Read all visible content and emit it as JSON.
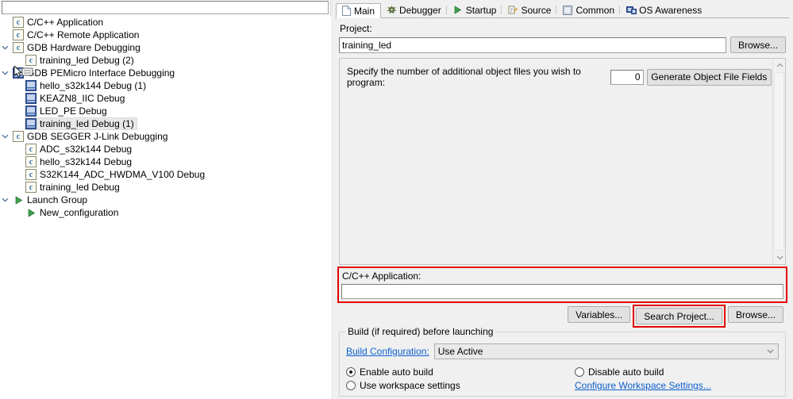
{
  "filter": {
    "value": "",
    "placeholder": ""
  },
  "tree": {
    "items": [
      {
        "label": "C/C++ Application",
        "icon": "c-launch-icon",
        "indent": 0,
        "twisty": "none",
        "selected": false
      },
      {
        "label": "C/C++ Remote Application",
        "icon": "c-launch-icon",
        "indent": 0,
        "twisty": "none",
        "selected": false
      },
      {
        "label": "GDB Hardware Debugging",
        "icon": "c-launch-icon",
        "indent": 0,
        "twisty": "expanded",
        "selected": false
      },
      {
        "label": "training_led Debug (2)",
        "icon": "c-launch-icon",
        "indent": 1,
        "twisty": "none",
        "selected": false
      },
      {
        "label": "GDB PEMicro Interface Debugging",
        "icon": "pemicro-icon",
        "indent": 0,
        "twisty": "expanded",
        "selected": false
      },
      {
        "label": "hello_s32k144 Debug (1)",
        "icon": "pemicro-icon",
        "indent": 1,
        "twisty": "none",
        "selected": false
      },
      {
        "label": "KEAZN8_IIC Debug",
        "icon": "pemicro-icon",
        "indent": 1,
        "twisty": "none",
        "selected": false
      },
      {
        "label": "LED_PE Debug",
        "icon": "pemicro-icon",
        "indent": 1,
        "twisty": "none",
        "selected": false
      },
      {
        "label": "training_led Debug (1)",
        "icon": "pemicro-icon",
        "indent": 1,
        "twisty": "none",
        "selected": true
      },
      {
        "label": "GDB SEGGER J-Link Debugging",
        "icon": "c-launch-icon",
        "indent": 0,
        "twisty": "expanded",
        "selected": false
      },
      {
        "label": "ADC_s32k144 Debug",
        "icon": "c-launch-icon",
        "indent": 1,
        "twisty": "none",
        "selected": false
      },
      {
        "label": "hello_s32k144 Debug",
        "icon": "c-launch-icon",
        "indent": 1,
        "twisty": "none",
        "selected": false
      },
      {
        "label": "S32K144_ADC_HWDMA_V100 Debug",
        "icon": "c-launch-icon",
        "indent": 1,
        "twisty": "none",
        "selected": false
      },
      {
        "label": "training_led Debug",
        "icon": "c-launch-icon",
        "indent": 1,
        "twisty": "none",
        "selected": false
      },
      {
        "label": "Launch Group",
        "icon": "play-icon",
        "indent": 0,
        "twisty": "expanded",
        "selected": false
      },
      {
        "label": "New_configuration",
        "icon": "play-icon",
        "indent": 1,
        "twisty": "none",
        "selected": false
      }
    ]
  },
  "tabs": [
    {
      "label": "Main",
      "icon": "document-icon",
      "active": true
    },
    {
      "label": "Debugger",
      "icon": "bug-icon",
      "active": false
    },
    {
      "label": "Startup",
      "icon": "play-icon",
      "active": false
    },
    {
      "label": "Source",
      "icon": "source-folder-icon",
      "active": false
    },
    {
      "label": "Common",
      "icon": "window-icon",
      "active": false
    },
    {
      "label": "OS Awareness",
      "icon": "os-awareness-icon",
      "active": false
    }
  ],
  "main": {
    "project_label": "Project:",
    "project_value": "training_led",
    "browse_project_label": "Browse...",
    "object_files_text": "Specify the number of additional object files you wish to program:",
    "object_files_count": "0",
    "generate_object_label": "Generate Object File Fields",
    "app_label": "C/C++ Application:",
    "app_value": "",
    "variables_label": "Variables...",
    "search_project_label": "Search Project...",
    "browse_app_label": "Browse...",
    "build_group_title": "Build (if required) before launching",
    "build_config_link": "Build Configuration:",
    "build_config_value": "Use Active",
    "radio_enable_auto_build": "Enable auto build",
    "radio_disable_auto_build": "Disable auto build",
    "radio_use_workspace_settings": "Use workspace settings",
    "configure_workspace_link": "Configure Workspace Settings..."
  },
  "colors": {
    "highlight_red": "#e50000",
    "link_blue": "#0b5fd0",
    "selection_gray": "#e8e8e8",
    "panel_gray": "#f0f0f0"
  }
}
